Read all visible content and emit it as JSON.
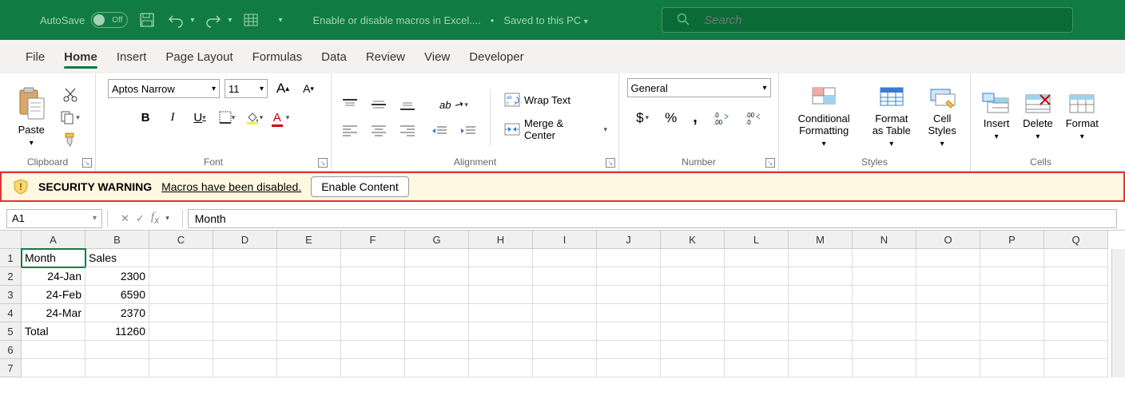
{
  "titlebar": {
    "autosave_label": "AutoSave",
    "autosave_state": "Off",
    "doc_name": "Enable or disable macros in Excel....",
    "save_status": "Saved to this PC",
    "search_placeholder": "Search"
  },
  "tabs": [
    "File",
    "Home",
    "Insert",
    "Page Layout",
    "Formulas",
    "Data",
    "Review",
    "View",
    "Developer"
  ],
  "active_tab": 1,
  "ribbon": {
    "clipboard": {
      "paste": "Paste",
      "label": "Clipboard"
    },
    "font": {
      "family": "Aptos Narrow",
      "size": "11",
      "bold": "B",
      "italic": "I",
      "underline": "U",
      "label": "Font"
    },
    "alignment": {
      "wrap": "Wrap Text",
      "merge": "Merge & Center",
      "label": "Alignment"
    },
    "number": {
      "format": "General",
      "label": "Number"
    },
    "styles": {
      "cond": "Conditional Formatting",
      "table": "Format as Table",
      "cell": "Cell Styles",
      "label": "Styles"
    },
    "cells": {
      "insert": "Insert",
      "delete": "Delete",
      "format": "Format",
      "label": "Cells"
    }
  },
  "warning": {
    "title": "SECURITY WARNING",
    "message": "Macros have been disabled.",
    "button": "Enable Content"
  },
  "formula_bar": {
    "cell_ref": "A1",
    "formula": "Month"
  },
  "columns": [
    "A",
    "B",
    "C",
    "D",
    "E",
    "F",
    "G",
    "H",
    "I",
    "J",
    "K",
    "L",
    "M",
    "N",
    "O",
    "P",
    "Q"
  ],
  "rows": [
    {
      "n": 1,
      "cells": [
        "Month",
        "Sales",
        "",
        "",
        "",
        "",
        "",
        "",
        "",
        "",
        "",
        "",
        "",
        "",
        "",
        "",
        ""
      ]
    },
    {
      "n": 2,
      "cells": [
        "24-Jan",
        "2300",
        "",
        "",
        "",
        "",
        "",
        "",
        "",
        "",
        "",
        "",
        "",
        "",
        "",
        "",
        ""
      ]
    },
    {
      "n": 3,
      "cells": [
        "24-Feb",
        "6590",
        "",
        "",
        "",
        "",
        "",
        "",
        "",
        "",
        "",
        "",
        "",
        "",
        "",
        "",
        ""
      ]
    },
    {
      "n": 4,
      "cells": [
        "24-Mar",
        "2370",
        "",
        "",
        "",
        "",
        "",
        "",
        "",
        "",
        "",
        "",
        "",
        "",
        "",
        "",
        ""
      ]
    },
    {
      "n": 5,
      "cells": [
        "Total",
        "11260",
        "",
        "",
        "",
        "",
        "",
        "",
        "",
        "",
        "",
        "",
        "",
        "",
        "",
        "",
        ""
      ]
    },
    {
      "n": 6,
      "cells": [
        "",
        "",
        "",
        "",
        "",
        "",
        "",
        "",
        "",
        "",
        "",
        "",
        "",
        "",
        "",
        "",
        ""
      ]
    },
    {
      "n": 7,
      "cells": [
        "",
        "",
        "",
        "",
        "",
        "",
        "",
        "",
        "",
        "",
        "",
        "",
        "",
        "",
        "",
        "",
        ""
      ]
    }
  ],
  "cell_align_right": {
    "1": [],
    "2": [
      0,
      1
    ],
    "3": [
      0,
      1
    ],
    "4": [
      0,
      1
    ],
    "5": [
      1
    ]
  }
}
